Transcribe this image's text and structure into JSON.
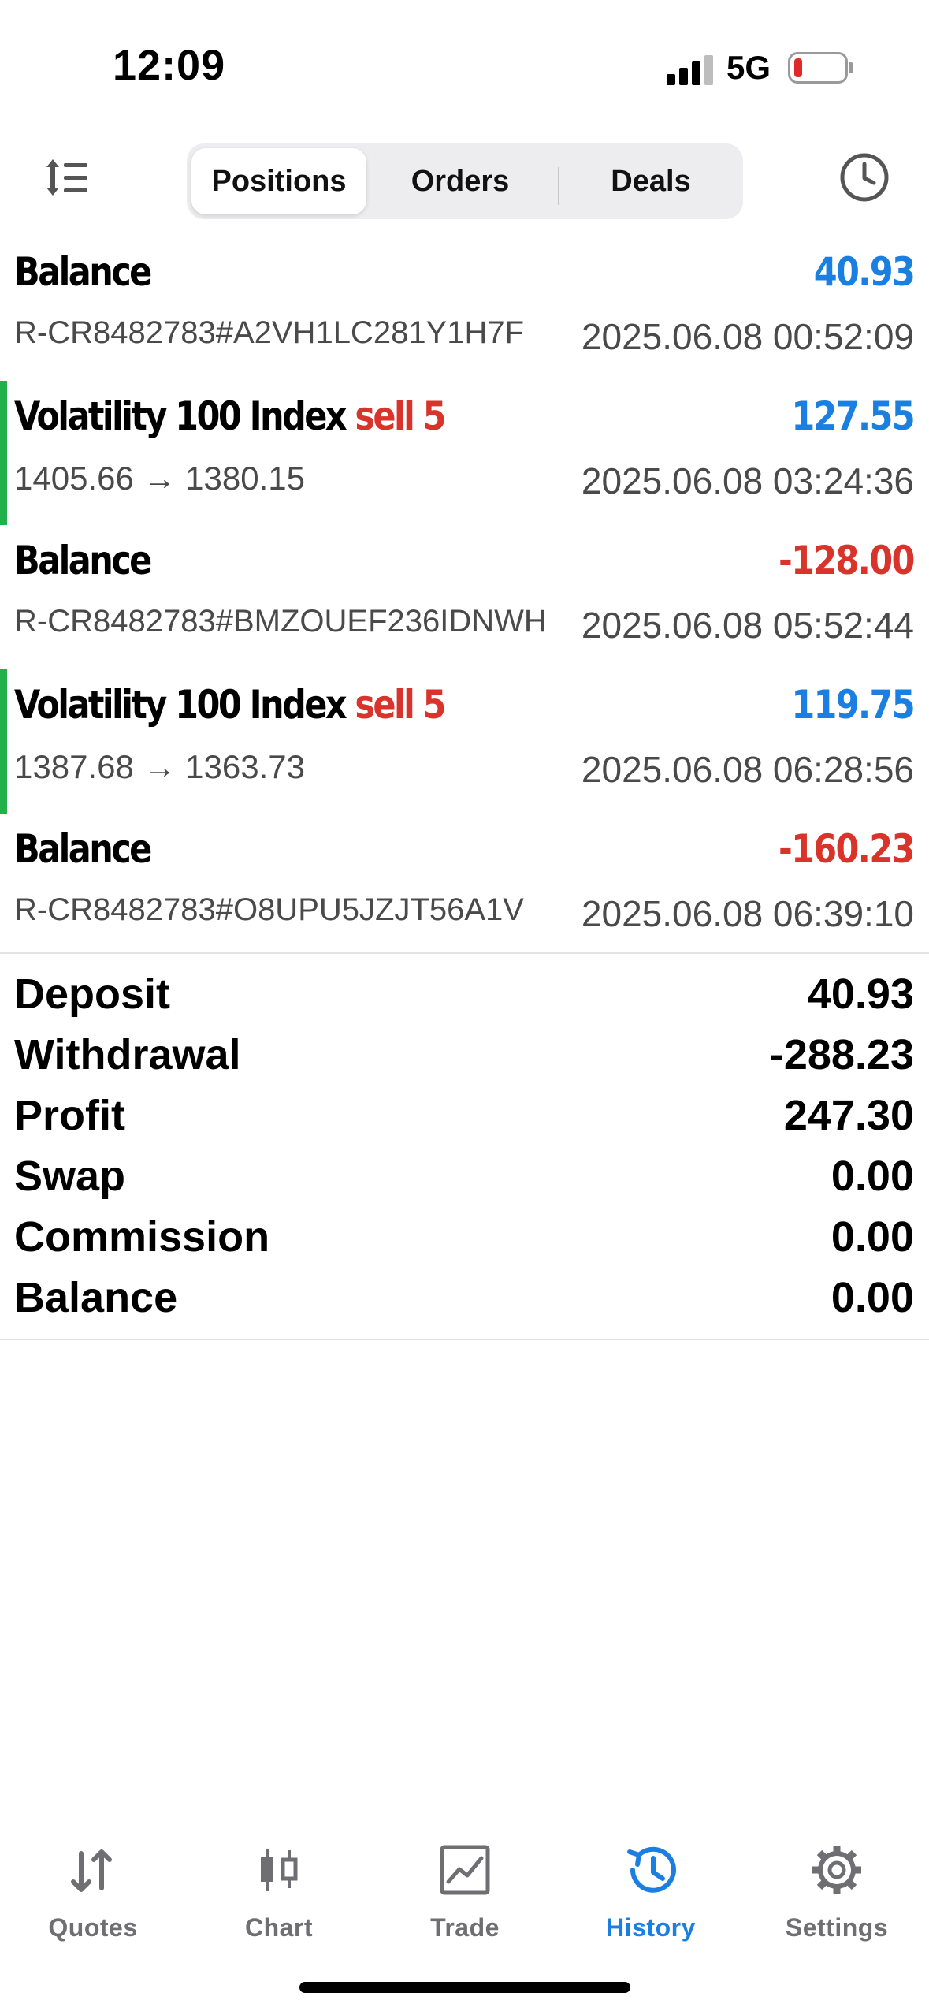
{
  "status_bar": {
    "time": "12:09",
    "network": "5G"
  },
  "toolbar": {
    "tabs": [
      {
        "label": "Positions",
        "active": true
      },
      {
        "label": "Orders",
        "active": false
      },
      {
        "label": "Deals",
        "active": false
      }
    ],
    "sort_icon": "sort-list-icon",
    "period_icon": "clock-icon"
  },
  "deals": [
    {
      "type": "balance",
      "title": "Balance",
      "amount": "40.93",
      "sub": "R-CR8482783#A2VH1LC281Y1H7F",
      "time": "2025.06.08 00:52:09"
    },
    {
      "type": "trade",
      "title": "Volatility 100 Index",
      "action": "sell 5",
      "amount": "127.55",
      "sub": "1405.66 → 1380.15",
      "time": "2025.06.08 03:24:36"
    },
    {
      "type": "balance",
      "title": "Balance",
      "amount": "-128.00",
      "sub": "R-CR8482783#BMZOUEF236IDNWH",
      "time": "2025.06.08 05:52:44"
    },
    {
      "type": "trade",
      "title": "Volatility 100 Index",
      "action": "sell 5",
      "amount": "119.75",
      "sub": "1387.68 → 1363.73",
      "time": "2025.06.08 06:28:56"
    },
    {
      "type": "balance",
      "title": "Balance",
      "amount": "-160.23",
      "sub": "R-CR8482783#O8UPU5JZJT56A1V",
      "time": "2025.06.08 06:39:10"
    }
  ],
  "summary": [
    {
      "label": "Deposit",
      "value": "40.93"
    },
    {
      "label": "Withdrawal",
      "value": "-288.23"
    },
    {
      "label": "Profit",
      "value": "247.30"
    },
    {
      "label": "Swap",
      "value": "0.00"
    },
    {
      "label": "Commission",
      "value": "0.00"
    },
    {
      "label": "Balance",
      "value": "0.00"
    }
  ],
  "tabbar": [
    {
      "label": "Quotes",
      "icon": "quotes-arrows-icon",
      "active": false
    },
    {
      "label": "Chart",
      "icon": "candlestick-icon",
      "active": false
    },
    {
      "label": "Trade",
      "icon": "trade-chart-icon",
      "active": false
    },
    {
      "label": "History",
      "icon": "history-clock-icon",
      "active": true
    },
    {
      "label": "Settings",
      "icon": "gear-icon",
      "active": false
    }
  ],
  "colors": {
    "accent": "#1a7fe0",
    "negative": "#d9342b",
    "trade_bar": "#22b04b"
  }
}
